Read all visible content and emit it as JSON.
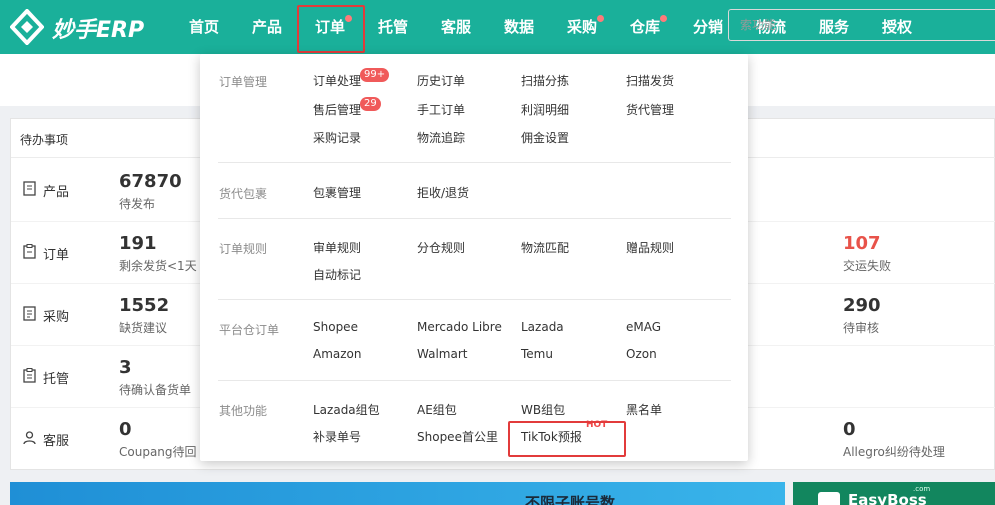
{
  "brand": {
    "name": "妙手ERP"
  },
  "nav": {
    "items": [
      {
        "label": "首页"
      },
      {
        "label": "产品"
      },
      {
        "label": "订单"
      },
      {
        "label": "托管"
      },
      {
        "label": "客服"
      },
      {
        "label": "数据"
      },
      {
        "label": "采购"
      },
      {
        "label": "仓库"
      },
      {
        "label": "分销"
      },
      {
        "label": "物流"
      },
      {
        "label": "服务"
      },
      {
        "label": "授权"
      }
    ],
    "active": "订单"
  },
  "search": {
    "placeholder": "索功能"
  },
  "todo": {
    "title": "待办事项",
    "rows": [
      {
        "label": "产品",
        "icon": "product-doc-icon",
        "stats": [
          {
            "num": "67870",
            "desc": "待发布"
          }
        ]
      },
      {
        "label": "订单",
        "icon": "order-clipboard-icon",
        "stats": [
          {
            "num": "191",
            "desc": "剩余发货<1天"
          },
          {
            "num": "107",
            "desc": "交运失败"
          }
        ]
      },
      {
        "label": "采购",
        "icon": "purchase-doc-icon",
        "stats": [
          {
            "num": "1552",
            "desc": "缺货建议"
          },
          {
            "num": "290",
            "desc": "待审核"
          }
        ]
      },
      {
        "label": "托管",
        "icon": "hosting-clipboard-icon",
        "stats": [
          {
            "num": "3",
            "desc": "待确认备货单"
          }
        ]
      },
      {
        "label": "客服",
        "icon": "service-user-icon",
        "stats": [
          {
            "num": "0",
            "desc": "Coupang待回"
          },
          {
            "num": "0",
            "desc": "Allegro纠纷待处理"
          }
        ]
      }
    ]
  },
  "dropdown": {
    "sections": [
      {
        "title": "订单管理",
        "items": [
          "订单处理",
          "历史订单",
          "扫描分拣",
          "扫描发货",
          "售后管理",
          "手工订单",
          "利润明细",
          "货代管理",
          "采购记录",
          "物流追踪",
          "佣金设置"
        ]
      },
      {
        "title": "货代包裹",
        "items": [
          "包裹管理",
          "拒收/退货"
        ]
      },
      {
        "title": "订单规则",
        "items": [
          "审单规则",
          "分仓规则",
          "物流匹配",
          "赠品规则",
          "自动标记"
        ]
      },
      {
        "title": "平台仓订单",
        "items": [
          "Shopee",
          "Mercado Libre",
          "Lazada",
          "eMAG",
          "Amazon",
          "Walmart",
          "Temu",
          "Ozon"
        ]
      },
      {
        "title": "其他功能",
        "items": [
          "Lazada组包",
          "AE组包",
          "WB组包",
          "黑名单",
          "补录单号",
          "Shopee首公里",
          "TikTok预报"
        ]
      }
    ],
    "badges": {
      "order_process": "99+",
      "after_sales": "29"
    },
    "hot_tag": "HOT"
  },
  "banners": {
    "left_text": "不限子账号数",
    "right_text": "EasyBoss",
    "right_suffix": ".com"
  },
  "colors": {
    "nav_bg": "#1ab09a",
    "highlight": "#e23b3b",
    "badge": "#f05a5a",
    "alert_red": "#e8534a"
  }
}
